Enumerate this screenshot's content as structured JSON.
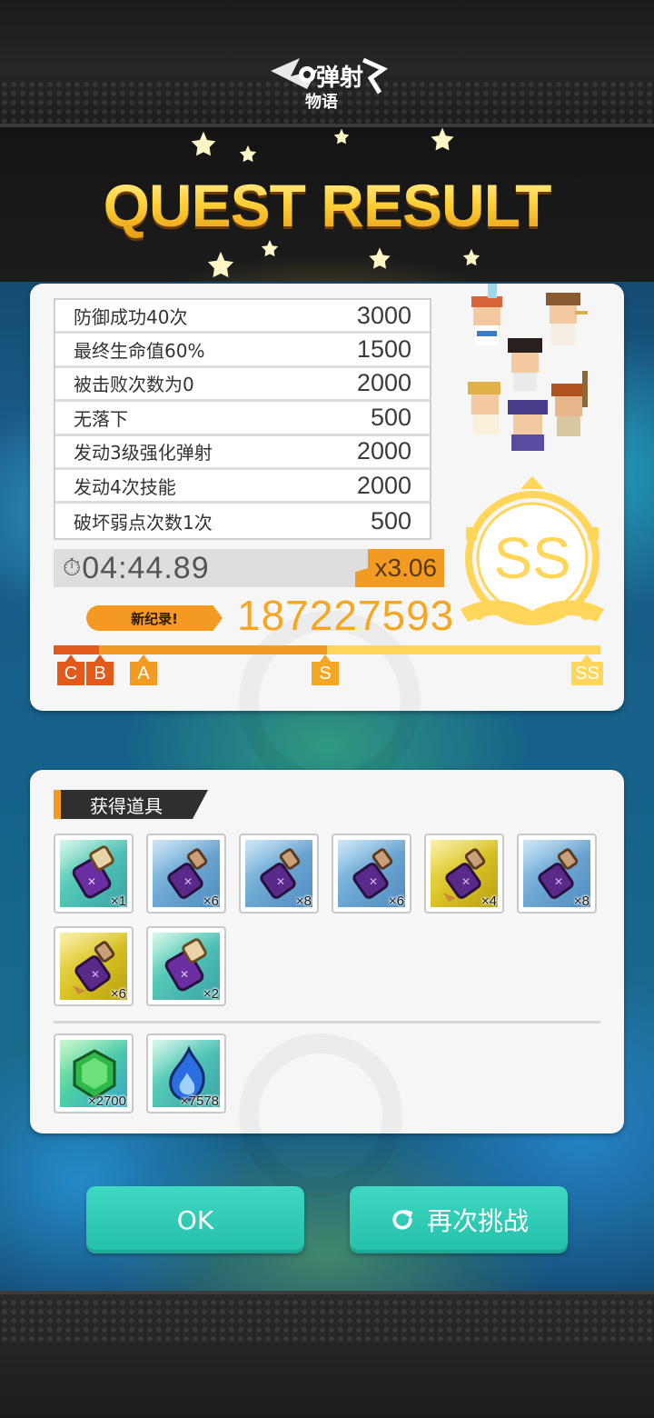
{
  "header": {
    "logo_text_top": "弹射",
    "logo_text_bottom": "物语",
    "title": "QUEST RESULT"
  },
  "result": {
    "missions": [
      {
        "name": "防御成功40次",
        "points": "3000"
      },
      {
        "name": "最终生命值60%",
        "points": "1500"
      },
      {
        "name": "被击败次数为0",
        "points": "2000"
      },
      {
        "name": "无落下",
        "points": "500"
      },
      {
        "name": "发动3级强化弹射",
        "points": "2000"
      },
      {
        "name": "发动4次技能",
        "points": "2000"
      },
      {
        "name": "破坏弱点次数1次",
        "points": "500"
      }
    ],
    "time": "04:44.89",
    "multiplier": "x3.06",
    "new_record_label": "新纪录!",
    "score": "187227593",
    "rank": "SS",
    "progress_fraction": 0.5,
    "grades": [
      "C",
      "B",
      "A",
      "S",
      "SS"
    ]
  },
  "items": {
    "header": "获得道具",
    "list": [
      {
        "type": "scroll",
        "bg": "teal",
        "count": "×1"
      },
      {
        "type": "potion",
        "bg": "blue",
        "count": "×6"
      },
      {
        "type": "potion",
        "bg": "blue",
        "count": "×8"
      },
      {
        "type": "potion",
        "bg": "blue",
        "count": "×6"
      },
      {
        "type": "potion-large",
        "bg": "gold",
        "count": "×4"
      },
      {
        "type": "potion",
        "bg": "blue",
        "count": "×8"
      },
      {
        "type": "potion-large",
        "bg": "gold",
        "count": "×6"
      },
      {
        "type": "scroll",
        "bg": "teal",
        "count": "×2"
      }
    ],
    "currency": [
      {
        "type": "green-gem-icon",
        "count": "×2700"
      },
      {
        "type": "blue-flame-icon",
        "count": "×7578"
      }
    ]
  },
  "buttons": {
    "ok": "OK",
    "retry": "再次挑战"
  },
  "colors": {
    "accent_orange": "#f29b22",
    "score_orange": "#f5a623",
    "rank_gold": "#ffd55a",
    "button_teal": "#2cc9b2"
  }
}
